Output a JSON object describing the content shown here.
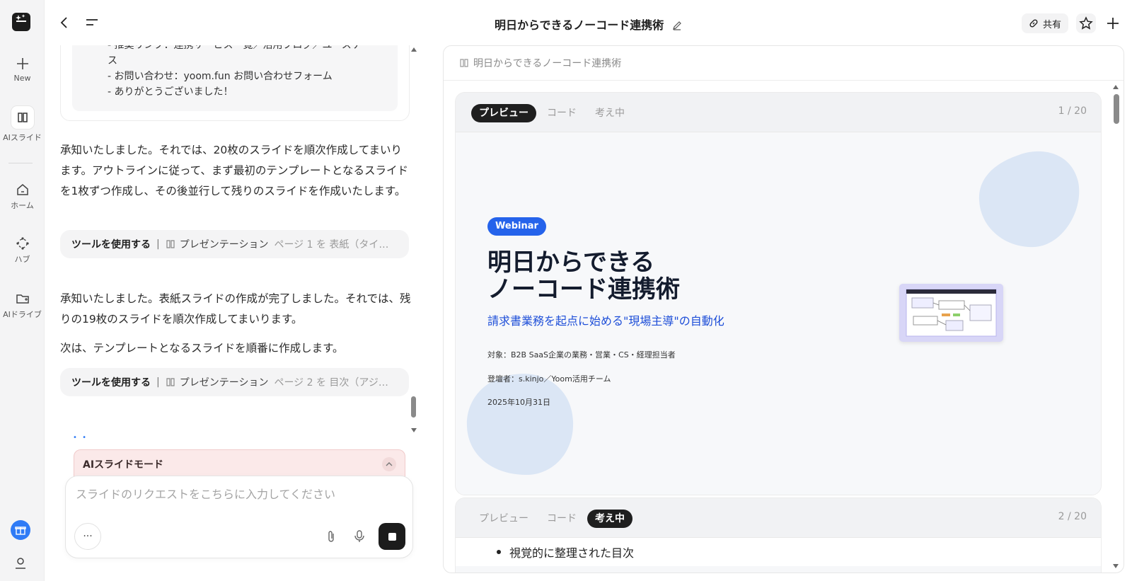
{
  "rail": {
    "new_label": "New",
    "ai_slide_label": "AIスライド",
    "home_label": "ホーム",
    "hub_label": "ハブ",
    "ai_drive_label": "AIドライブ"
  },
  "header": {
    "title": "明日からできるノーコード連携術",
    "share_label": "共有"
  },
  "chat": {
    "quote_lines": [
      "- 推奨リンク：連携サービス一覧／活用ブログ／ユースケー",
      "ス",
      "- お問い合わせ：yoom.fun お問い合わせフォーム",
      "- ありがとうございました！"
    ],
    "messages": [
      "承知いたしました。それでは、20枚のスライドを順次作成してまいります。アウトラインに従って、まず最初のテンプレートとなるスライドを1枚ずつ作成し、その後並行して残りのスライドを作成いたします。",
      "承知いたしました。表紙スライドの作成が完了しました。それでは、残りの19枚のスライドを順次作成してまいります。",
      "次は、テンプレートとなるスライドを順番に作成します。"
    ],
    "tool_calls": [
      {
        "action": "ツールを使用する",
        "tool": "プレゼンテーション",
        "detail": "ページ 1 を 表紙（タイ…"
      },
      {
        "action": "ツールを使用する",
        "tool": "プレゼンテーション",
        "detail": "ページ 2 を 目次（アジ…"
      }
    ],
    "mode_label": "AIスライドモード",
    "composer_placeholder": "スライドのリクエストをこちらに入力してください",
    "more_label": "···"
  },
  "preview": {
    "doc_name": "明日からできるノーコード連携術",
    "cards": [
      {
        "tabs": [
          "プレビュー",
          "コード",
          "考え中"
        ],
        "active_tab": "プレビュー",
        "page": "1 / 20",
        "slide": {
          "badge": "Webinar",
          "title_line1": "明日からできる",
          "title_line2": "ノーコード連携術",
          "subtitle": "請求書業務を起点に始める\"現場主導\"の自動化",
          "audience": "対象：B2B SaaS企業の業務・営業・CS・経理担当者",
          "presenter": "登壇者：s.kinjo／Yoom活用チーム",
          "date": "2025年10月31日"
        }
      },
      {
        "tabs": [
          "プレビュー",
          "コード",
          "考え中"
        ],
        "active_tab": "考え中",
        "page": "2 / 20",
        "bullet": "視覚的に整理された目次"
      }
    ]
  },
  "colors": {
    "accent_blue": "#2563eb",
    "slide_title": "#141c2e",
    "blob": "#dbe6f5",
    "mode_panel": "#fbe9e9"
  }
}
